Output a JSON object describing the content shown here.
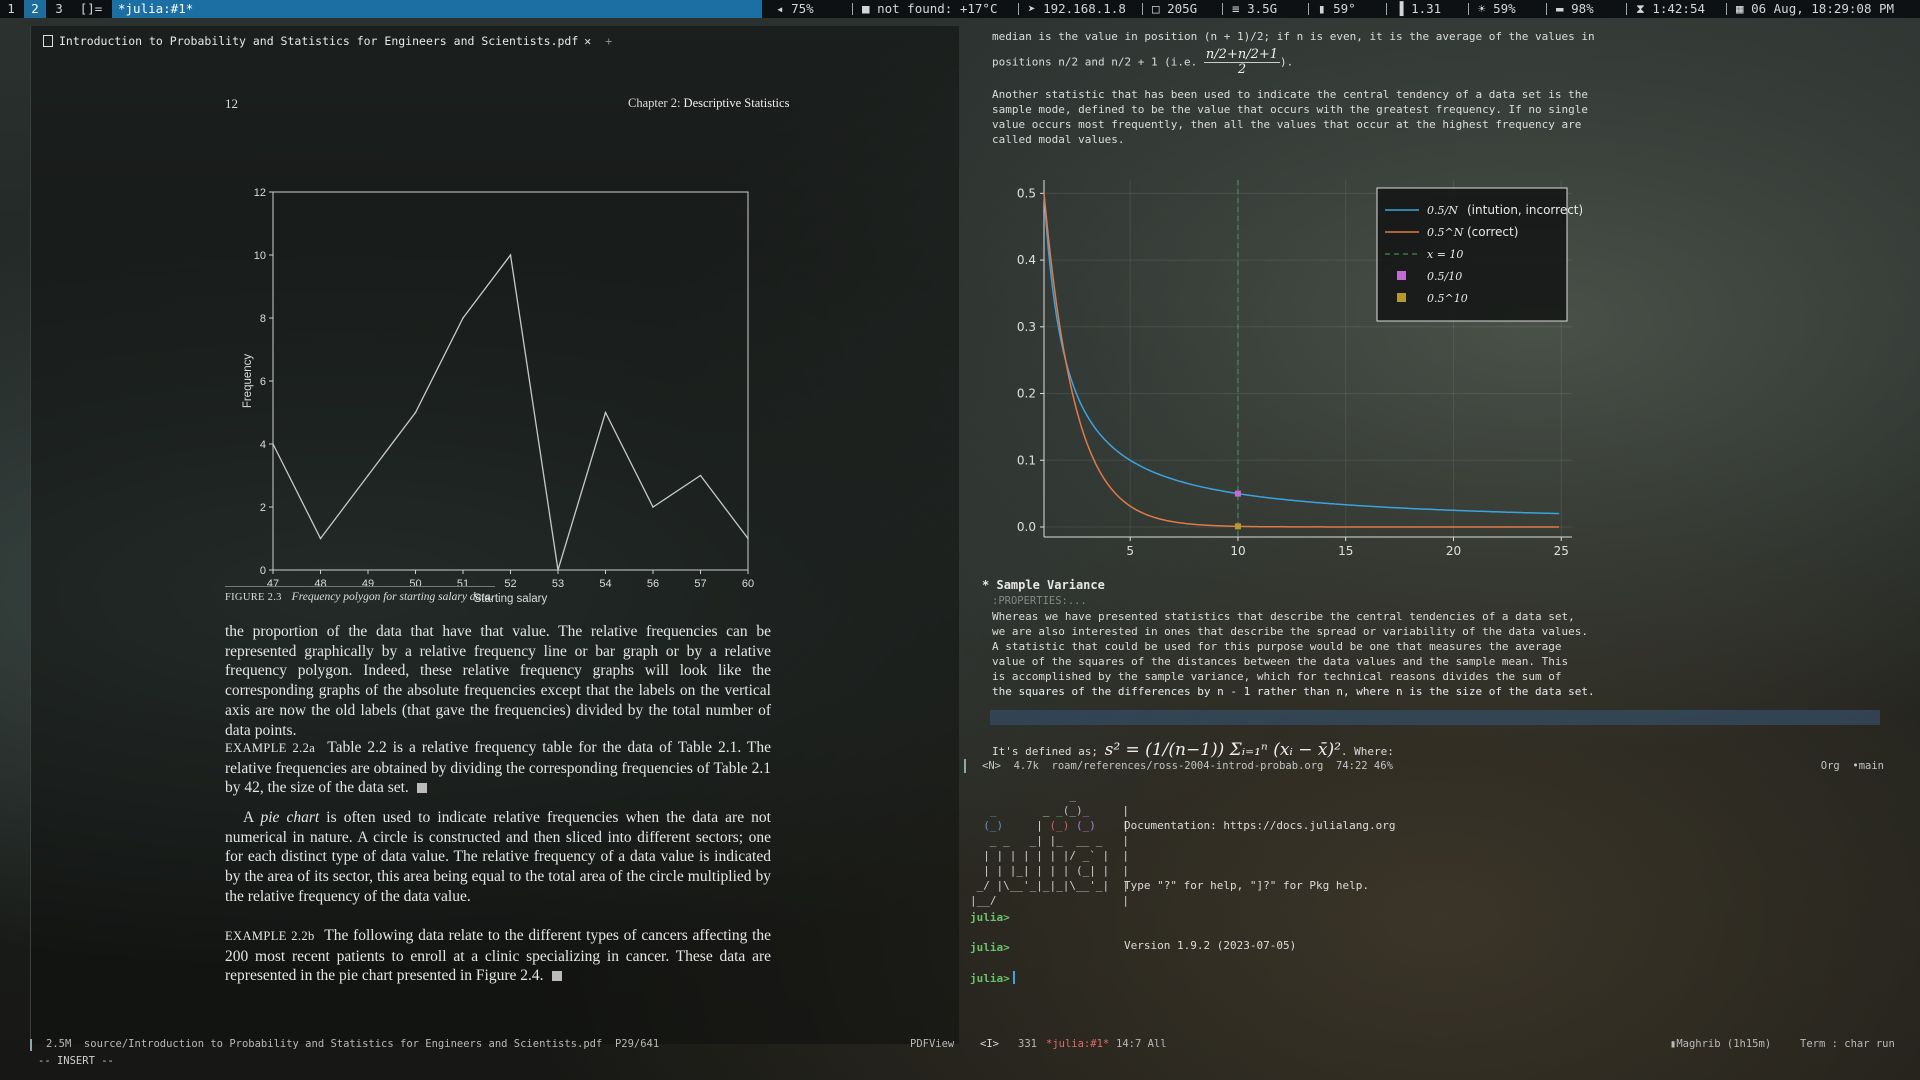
{
  "topbar": {
    "workspaces": [
      "1",
      "2",
      "3",
      "[]="
    ],
    "active_workspace": "2",
    "window_title": "*julia:#1*",
    "status": [
      {
        "icon": "volume-icon",
        "glyph": "◂",
        "text": "75%"
      },
      {
        "icon": "weather-icon",
        "glyph": "■",
        "text": "not found: +17°C"
      },
      {
        "icon": "network-icon",
        "glyph": "➤",
        "text": "192.168.1.8"
      },
      {
        "icon": "disk-icon",
        "glyph": "□",
        "text": "205G"
      },
      {
        "icon": "memory-icon",
        "glyph": "≡",
        "text": "3.5G"
      },
      {
        "icon": "temperature-icon",
        "glyph": "▮",
        "text": "59°"
      },
      {
        "icon": "load-icon",
        "glyph": "▐",
        "text": "1.31"
      },
      {
        "icon": "brightness-icon",
        "glyph": "☀",
        "text": "59%"
      },
      {
        "icon": "battery-icon",
        "glyph": "▬",
        "text": "98%"
      },
      {
        "icon": "hourglass-icon",
        "glyph": "⧗",
        "text": "1:42:54"
      },
      {
        "icon": "calendar-icon",
        "glyph": "▦",
        "text": "06 Aug, 18:29:08 PM"
      }
    ]
  },
  "pdf": {
    "tab_title": "Introduction to Probability and Statistics for Engineers and Scientists.pdf",
    "tab_close": "✕",
    "tab_add": "+",
    "page_number": "12",
    "chapter_prefix": "Chapter 2:",
    "chapter_title": "Descriptive Statistics",
    "figure_label": "FIGURE 2.3",
    "figure_caption": "Frequency polygon for starting salary data.",
    "paragraph1": "the proportion of the data that have that value. The relative frequencies can be represented graphically by a relative frequency line or bar graph or by a relative frequency polygon. Indeed, these relative frequency graphs will look like the corresponding graphs of the absolute frequencies except that the labels on the vertical axis are now the old labels (that gave the frequencies) divided by the total number of data points.",
    "example_a_label": "EXAMPLE 2.2a",
    "example_a_text": "Table 2.2 is a relative frequency table for the data of Table 2.1. The relative frequencies are obtained by dividing the corresponding frequencies of Table 2.1 by 42, the size of the data set.",
    "pie_prefix": "A ",
    "pie_term": "pie chart",
    "pie_text": " is often used to indicate relative frequencies when the data are not numerical in nature. A circle is constructed and then sliced into different sectors; one for each distinct type of data value. The relative frequency of a data value is indicated by the area of its sector, this area being equal to the total area of the circle multiplied by the relative frequency of the data value.",
    "example_b_label": "EXAMPLE 2.2b",
    "example_b_text": "The following data relate to the different types of cancers affecting the 200 most recent patients to enroll at a clinic specializing in cancer. These data are represented in the pie chart presented in Figure 2.4."
  },
  "org": {
    "median_line1": "median is the value in position (n + 1)/2; if n is even, it is the average of the values in",
    "median_line2": "positions n/2 and n/2 + 1 (i.e. ",
    "median_frac_num": "n/2+n/2+1",
    "median_frac_den": "2",
    "median_line2_end": ").",
    "mode_lines": [
      "Another statistic that has been used to indicate the central tendency of a data set is the",
      "sample mode, defined to be the value that occurs with the greatest frequency. If no single",
      "value occurs most frequently, then all the values that occur at the highest frequency are",
      "called modal values."
    ],
    "heading_bullet": "*",
    "heading": "Sample Variance",
    "properties": ":PROPERTIES:...",
    "variance_lines": [
      "Whereas we have presented statistics that describe the central tendencies of a data set,",
      "we are also interested in ones that describe the spread or variability of the data values.",
      "A statistic that could be used for this purpose would be one that measures the average",
      "value of the squares of the distances between the data values and the sample mean. This",
      "is accomplished by the sample variance, which for technical reasons divides the sum of",
      "the squares of the differences by n - 1 rather than n, where n is the size of the data set."
    ],
    "defined_prefix": "It's defined as; ",
    "defined_formula": "s² = (1/(n−1)) Σᵢ₌₁ⁿ (xᵢ − x̄)²",
    "defined_suffix": ". Where:"
  },
  "org_modeline": {
    "left": "<N>  4.7k  roam/references/ross-2004-introd-probab.org  74:22 46%",
    "right": "Org  •main"
  },
  "julia": {
    "doc": "Documentation: https://docs.julialang.org",
    "help": "Type \"?\" for help, \"]?\" for Pkg help.",
    "version": "Version 1.9.2 (2023-07-05)",
    "prompt": "julia>"
  },
  "bottom_modeline": {
    "size_path": "2.5M  source/Introduction to Probability and Statistics for Engineers and Scientists.pdf  P29/641",
    "mode": "PDFView",
    "insert_tag": "<I>",
    "line_count": "331",
    "buffer": "*julia:#1*",
    "position": "14:7 All",
    "prayer": "Maghrib (1h15m)",
    "term": "Term : char run"
  },
  "minibuffer": "-- INSERT --",
  "chart_data": [
    {
      "type": "line",
      "title": "",
      "xlabel": "Starting salary",
      "ylabel": "Frequency",
      "categories": [
        "47",
        "48",
        "49",
        "50",
        "51",
        "52",
        "53",
        "54",
        "56",
        "57",
        "60"
      ],
      "values": [
        4,
        1,
        3,
        5,
        8,
        10,
        0,
        5,
        2,
        3,
        1
      ],
      "yticks": [
        "0",
        "2",
        "4",
        "6",
        "8",
        "10",
        "12"
      ],
      "ylim": [
        0,
        12
      ],
      "grid": false,
      "line_color": "#c8c8c8"
    },
    {
      "type": "line",
      "title": "",
      "xlabel": "",
      "ylabel": "",
      "xlim": [
        1,
        25.5
      ],
      "ylim": [
        -0.015,
        0.52
      ],
      "xticks": [
        "5",
        "10",
        "15",
        "20",
        "25"
      ],
      "yticks": [
        "0.0",
        "0.1",
        "0.2",
        "0.3",
        "0.4",
        "0.5"
      ],
      "grid": true,
      "legend_position": "top-right",
      "series": [
        {
          "name": "(intution, incorrect)",
          "legend_math": "0.5/N",
          "formula": "0.5/N",
          "color": "#3aa4e0",
          "style": "line"
        },
        {
          "name": "(correct)",
          "legend_math": "0.5^N",
          "formula": "0.5^N",
          "color": "#e07a48",
          "style": "line"
        },
        {
          "legend_math": "x = 10",
          "x": 10,
          "color": "#3d8a55",
          "style": "dashed-vline"
        },
        {
          "legend_math": "0.5/10",
          "points": [
            [
              10,
              0.05
            ]
          ],
          "color": "#c26bd2",
          "style": "marker"
        },
        {
          "legend_math": "0.5^10",
          "points": [
            [
              10,
              0.0009765625
            ]
          ],
          "color": "#b59a2f",
          "style": "marker"
        }
      ]
    }
  ]
}
